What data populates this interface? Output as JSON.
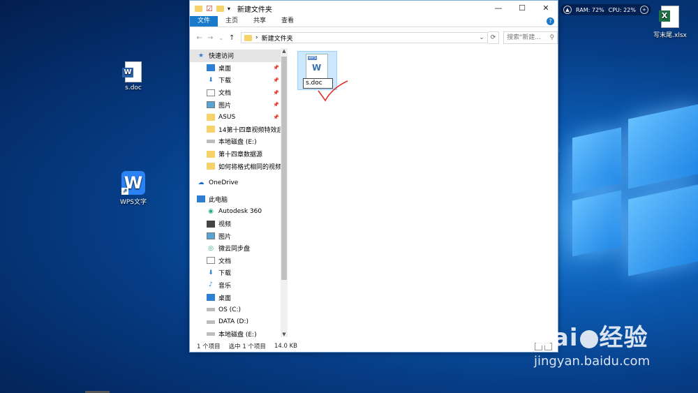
{
  "desktop": {
    "icons": [
      {
        "label": "s.doc"
      },
      {
        "label": "WPS文字"
      },
      {
        "label": "写末尾.xlsx"
      }
    ],
    "sysmon": {
      "ram": "RAM: 72%",
      "cpu": "CPU: 22%"
    }
  },
  "window": {
    "title": "新建文件夹",
    "controls": {
      "minimize": "—",
      "maximize": "☐",
      "close": "✕"
    },
    "ribbon_tabs": [
      "文件",
      "主页",
      "共享",
      "查看"
    ],
    "help": "?",
    "address": {
      "back": "←",
      "forward": "→",
      "recent": "⌄",
      "up": "↑",
      "path_separator": "›",
      "path": "新建文件夹",
      "refresh": "⟳",
      "search_placeholder": "搜索\"新建...",
      "search_icon": "⚲"
    },
    "nav": {
      "quick_access": "快速访问",
      "quick_items": [
        {
          "label": "桌面",
          "pinned": true
        },
        {
          "label": "下载",
          "pinned": true
        },
        {
          "label": "文档",
          "pinned": true
        },
        {
          "label": "图片",
          "pinned": true
        },
        {
          "label": "ASUS",
          "pinned": true
        },
        {
          "label": "14第十四章视频特效后",
          "pinned": false
        },
        {
          "label": "本地磁盘 (E:)",
          "pinned": false
        },
        {
          "label": "第十四章数据源",
          "pinned": false
        },
        {
          "label": "如何将格式相同的视频",
          "pinned": false
        }
      ],
      "onedrive": "OneDrive",
      "this_pc": "此电脑",
      "pc_items": [
        "Autodesk 360",
        "视频",
        "图片",
        "微云同步盘",
        "文档",
        "下载",
        "音乐",
        "桌面",
        "OS (C:)",
        "DATA (D:)",
        "本地磁盘 (E:)"
      ],
      "pin_glyph": "📌"
    },
    "content": {
      "file": {
        "tag": "WPS",
        "glyph": "W",
        "rename_value": "s.doc"
      }
    },
    "status": {
      "count": "1 个项目",
      "selected": "选中 1 个项目",
      "size": "14.0 KB"
    }
  },
  "watermark": {
    "logo_left": "Bai",
    "logo_right": "经验",
    "url": "jingyan.baidu.com"
  },
  "colors": {
    "accent": "#1979ca",
    "selection": "#cce8ff",
    "checkmark": "#e0302a"
  }
}
